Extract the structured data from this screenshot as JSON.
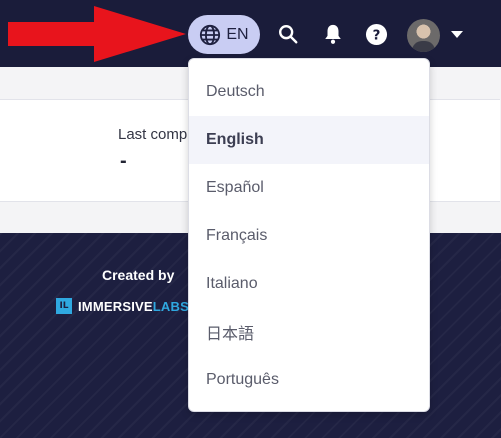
{
  "header": {
    "language_button": {
      "code": "EN"
    },
    "icons": [
      "globe-icon",
      "search-icon",
      "bell-icon",
      "help-icon",
      "avatar",
      "caret-down-icon"
    ]
  },
  "language_menu": {
    "items": [
      {
        "label": "Deutsch",
        "selected": false
      },
      {
        "label": "English",
        "selected": true
      },
      {
        "label": "Español",
        "selected": false
      },
      {
        "label": "Français",
        "selected": false
      },
      {
        "label": "Italiano",
        "selected": false
      },
      {
        "label": "日本語",
        "selected": false
      },
      {
        "label": "Português",
        "selected": false
      }
    ]
  },
  "main": {
    "card": {
      "label": "Last comp",
      "value": "-"
    }
  },
  "footer": {
    "created_by": "Created by",
    "logo_mark": "IL",
    "logo_text_primary": "IMMERSIVE",
    "logo_text_accent": "LABS"
  },
  "annotation": {
    "arrow_color": "#e8141c"
  },
  "colors": {
    "nav_bg": "#1a1c3a",
    "language_button_bg": "#c9cdf3",
    "footer_bg": "#1d1f40",
    "logo_accent": "#2fa8e0"
  }
}
